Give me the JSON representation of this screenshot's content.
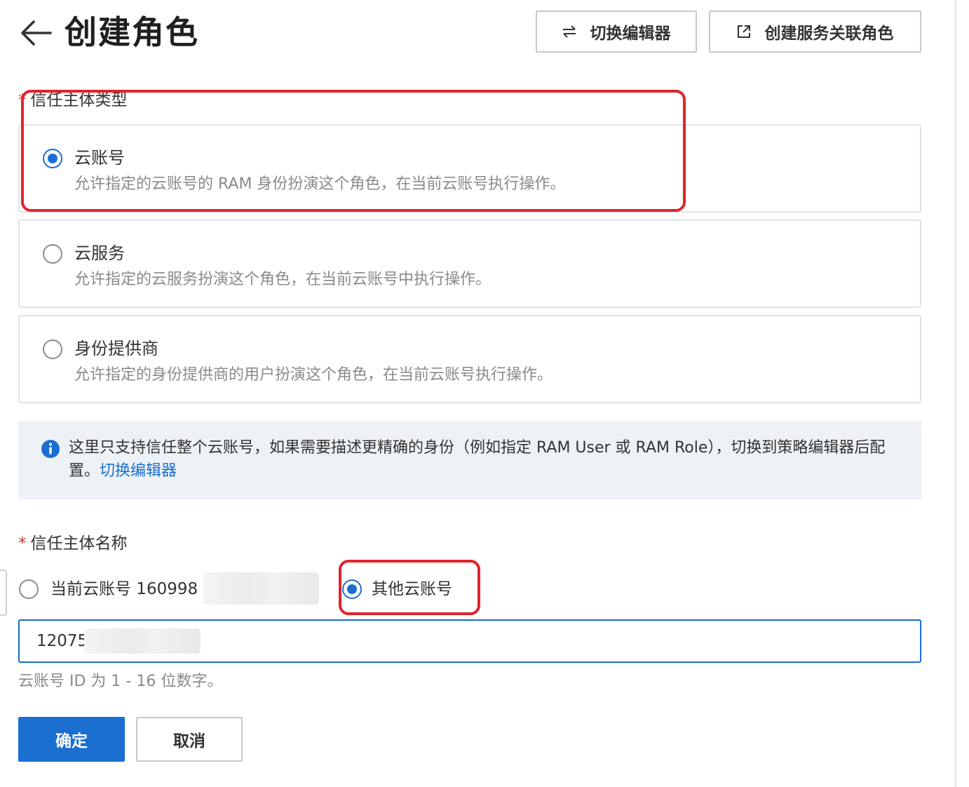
{
  "header": {
    "title": "创建角色",
    "switch_editor_label": "切换编辑器",
    "create_service_role_label": "创建服务关联角色"
  },
  "trust_type": {
    "label": "信任主体类型",
    "options": [
      {
        "title": "云账号",
        "desc": "允许指定的云账号的 RAM 身份扮演这个角色，在当前云账号执行操作。",
        "selected": true
      },
      {
        "title": "云服务",
        "desc": "允许指定的云服务扮演这个角色，在当前云账号中执行操作。",
        "selected": false
      },
      {
        "title": "身份提供商",
        "desc": "允许指定的身份提供商的用户扮演这个角色，在当前云账号执行操作。",
        "selected": false
      }
    ]
  },
  "info": {
    "text": "这里只支持信任整个云账号，如果需要描述更精确的身份（例如指定 RAM User 或 RAM Role），切换到策略编辑器后配置。",
    "link": "切换编辑器"
  },
  "trust_name": {
    "required_mark": "*",
    "label": "信任主体名称",
    "current_account_label": "当前云账号 160998",
    "other_account_label": "其他云账号",
    "selected": "other",
    "input_value": "12075",
    "help": "云账号 ID 为 1 - 16 位数字。"
  },
  "actions": {
    "confirm": "确定",
    "cancel": "取消"
  },
  "colors": {
    "accent": "#1b6fd1",
    "highlight": "#e0232e",
    "info_bg": "#eef2f7"
  }
}
